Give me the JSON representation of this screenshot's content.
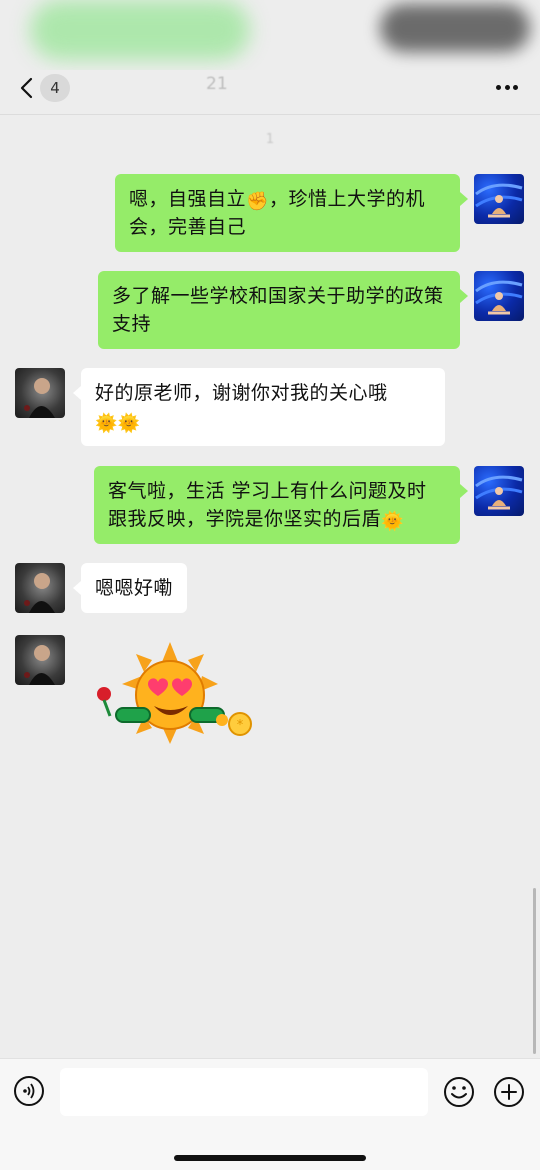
{
  "nav": {
    "badge_count": "4",
    "title": "21"
  },
  "time_label": "1",
  "messages": [
    {
      "side": "out",
      "text": "嗯，自强自立",
      "emoji": "✊",
      "tail": "，珍惜上大学的机会，完善自己"
    },
    {
      "side": "out",
      "text": "多了解一些学校和国家关于助学的政策支持"
    },
    {
      "side": "in",
      "text": "好的原老师，谢谢你对我的关心哦",
      "emoji": "🌞🌞"
    },
    {
      "side": "out",
      "text": "客气啦，生活 学习上有什么问题及时跟我反映，学院是你坚实的后盾",
      "emoji": "🌞"
    },
    {
      "side": "in",
      "text": "嗯嗯好嘞"
    }
  ],
  "input": {
    "placeholder": ""
  },
  "colors": {
    "background": "#ededed",
    "out_bubble": "#95ec69",
    "in_bubble": "#ffffff",
    "input_bar": "#f7f7f7"
  },
  "icons": {
    "back": "chevron-left-icon",
    "more": "more-dots-icon",
    "voice": "voice-icon",
    "emoji": "smile-icon",
    "plus": "plus-circle-icon",
    "sticker": "sun-heart-eyes-sticker"
  }
}
